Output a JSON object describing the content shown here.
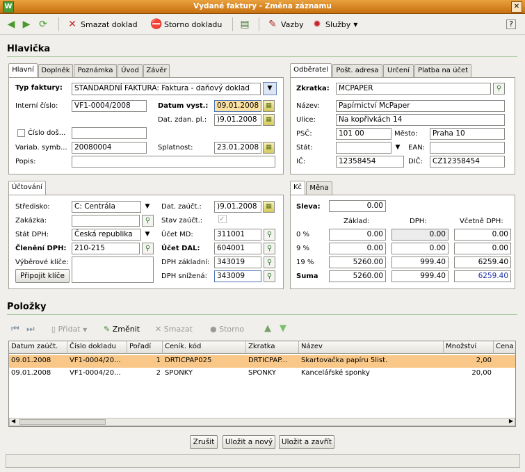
{
  "window": {
    "title": "Vydané faktury - Změna záznamu",
    "app_letter": "W",
    "close_glyph": "✕"
  },
  "toolbar": {
    "delete": "Smazat doklad",
    "storno": "Storno dokladu",
    "links": "Vazby",
    "services": "Služby"
  },
  "header": {
    "title": "Hlavička"
  },
  "main_tabs": [
    "Hlavní",
    "Doplněk",
    "Poznámka",
    "Úvod",
    "Závěr"
  ],
  "main": {
    "invoice_type_label": "Typ faktury:",
    "invoice_type": "STANDARDNÍ FAKTURA: Faktura - daňový doklad",
    "internal_no_label": "Interní číslo:",
    "internal_no": "VF1-0004/2008",
    "issue_date_label": "Datum vyst.:",
    "issue_date": "09.01.2008",
    "tax_date_label": "Dat. zdan. pl.:",
    "tax_date": ")9.01.2008",
    "received_no_label": "Číslo doš...",
    "received_no": "",
    "var_symbol_label": "Variab. symb...",
    "var_symbol": "20080004",
    "due_date_label": "Splatnost:",
    "due_date": "23.01.2008",
    "desc_label": "Popis:",
    "desc": ""
  },
  "customer_tabs": [
    "Odběratel",
    "Pošt. adresa",
    "Určení",
    "Platba na účet"
  ],
  "customer": {
    "code_label": "Zkratka:",
    "code": "MCPAPER",
    "name_label": "Název:",
    "name": "Papírnictví McPaper",
    "street_label": "Ulice:",
    "street": "Na kopřivkách 14",
    "zip_label": "PSČ:",
    "zip": "101 00",
    "city_label": "Město:",
    "city": "Praha 10",
    "country_label": "Stát:",
    "country": "",
    "ean_label": "EAN:",
    "ean": "",
    "ico_label": "IČ:",
    "ico": "12358454",
    "dic_label": "DIČ:",
    "dic": "CZ12358454"
  },
  "account_tabs": [
    "Účtování"
  ],
  "account": {
    "center_label": "Středisko:",
    "center": "C: Centrála",
    "contract_label": "Zakázka:",
    "contract": "",
    "vat_country_label": "Stát DPH:",
    "vat_country": "Česká republika",
    "vat_split_label": "Členění DPH:",
    "vat_split": "210-215",
    "keys_label": "Výběrové klíče:",
    "attach_keys": "Připojit klíče",
    "acc_date_label": "Dat. zaúčt.:",
    "acc_date": ")9.01.2008",
    "acc_state_label": "Stav zaúčt.:",
    "md_label": "Účet MD:",
    "md": "311001",
    "dal_label": "Účet DAL:",
    "dal": "604001",
    "vat_base_label": "DPH základní:",
    "vat_base": "343019",
    "vat_reduced_label": "DPH snížená:",
    "vat_reduced": "343009"
  },
  "sum_tabs": [
    "Kč",
    "Měna"
  ],
  "sums": {
    "discount_label": "Sleva:",
    "discount": "0.00",
    "col_base": "Základ:",
    "col_vat": "DPH:",
    "col_total": "Včetně DPH:",
    "rows": [
      {
        "label": "0 %",
        "base": "0.00",
        "vat": "0.00",
        "total": "0.00"
      },
      {
        "label": "9 %",
        "base": "0.00",
        "vat": "0.00",
        "total": "0.00"
      },
      {
        "label": "19 %",
        "base": "5260.00",
        "vat": "999.40",
        "total": "6259.40"
      },
      {
        "label": "Suma",
        "base": "5260.00",
        "vat": "999.40",
        "total": "6259.40"
      }
    ]
  },
  "items": {
    "title": "Položky",
    "add": "Přidat",
    "edit": "Změnit",
    "delete": "Smazat",
    "storno": "Storno"
  },
  "table": {
    "headers": [
      "Datum zaúčt.",
      "Číslo dokladu",
      "Pořadí",
      "Ceník. kód",
      "Zkratka",
      "Název",
      "Množství",
      "Cena"
    ],
    "rows": [
      [
        "09.01.2008",
        "VF1-0004/20...",
        "1",
        "DRTICPAP025",
        "DRTICPAP...",
        "Skartovačka papíru 5list.",
        "2,00",
        ""
      ],
      [
        "09.01.2008",
        "VF1-0004/20...",
        "2",
        "SPONKY",
        "SPONKY",
        "Kancelářské sponky",
        "20,00",
        ""
      ]
    ]
  },
  "footer": {
    "cancel": "Zrušit",
    "save_new": "Uložit a nový",
    "save_close": "Uložit a zavřít"
  },
  "colors": {
    "title_bar": "#d9831f",
    "selected_row": "#f9c888",
    "section_line": "#a8c9a0"
  }
}
